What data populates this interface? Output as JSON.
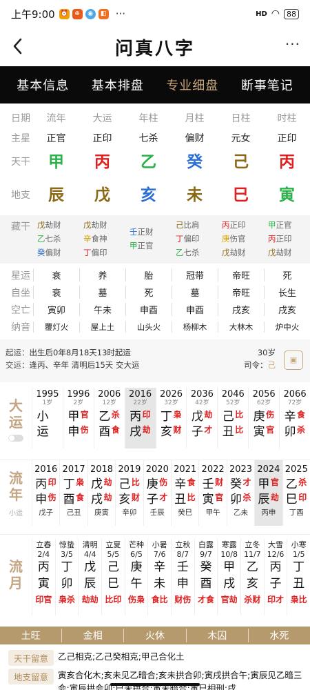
{
  "status_bar": {
    "time": "上午9:00",
    "signal": "HD",
    "battery": "88"
  },
  "header": {
    "title": "问真八字"
  },
  "tabs": [
    {
      "label": "基本信息",
      "active": false
    },
    {
      "label": "基本排盘",
      "active": false
    },
    {
      "label": "专业细盘",
      "active": true
    },
    {
      "label": "断事笔记",
      "active": false
    }
  ],
  "pillars": {
    "labels": {
      "date": "日期",
      "zhuxing": "主星",
      "tiangan": "天干",
      "dizhi": "地支",
      "canggan": "藏干",
      "xingyun": "星运",
      "zizuo": "自坐",
      "kongwang": "空亡",
      "nayin": "纳音"
    },
    "columns": [
      {
        "name": "流年",
        "zhuxing": "正官",
        "gan": "甲",
        "gan_el": "wood",
        "zhi": "辰",
        "zhi_el": "earth",
        "canggan": [
          {
            "g": "戊",
            "el": "earth",
            "s": "劫财"
          },
          {
            "g": "乙",
            "el": "wood",
            "s": "七杀"
          },
          {
            "g": "癸",
            "el": "water",
            "s": "偏财"
          }
        ],
        "xingyun": "衰",
        "zizuo": "衰",
        "kong": "寅卯",
        "nayin": "覆灯火"
      },
      {
        "name": "大运",
        "zhuxing": "正印",
        "gan": "丙",
        "gan_el": "fire",
        "zhi": "戊",
        "zhi_el": "earth",
        "canggan": [
          {
            "g": "戊",
            "el": "earth",
            "s": "劫财"
          },
          {
            "g": "辛",
            "el": "metal",
            "s": "食神"
          },
          {
            "g": "丁",
            "el": "fire",
            "s": "偏印"
          }
        ],
        "xingyun": "养",
        "zizuo": "墓",
        "kong": "午未",
        "nayin": "屋上土"
      },
      {
        "name": "年柱",
        "zhuxing": "七杀",
        "gan": "乙",
        "gan_el": "wood",
        "zhi": "亥",
        "zhi_el": "water",
        "canggan": [
          {
            "g": "壬",
            "el": "water",
            "s": "正财"
          },
          {
            "g": "甲",
            "el": "wood",
            "s": "正官"
          }
        ],
        "xingyun": "胎",
        "zizuo": "死",
        "kong": "申酉",
        "nayin": "山头火"
      },
      {
        "name": "月柱",
        "zhuxing": "偏财",
        "gan": "癸",
        "gan_el": "water",
        "zhi": "未",
        "zhi_el": "earth",
        "canggan": [
          {
            "g": "己",
            "el": "earth",
            "s": "比肩"
          },
          {
            "g": "丁",
            "el": "fire",
            "s": "偏印"
          },
          {
            "g": "乙",
            "el": "wood",
            "s": "七杀"
          }
        ],
        "xingyun": "冠带",
        "zizuo": "墓",
        "kong": "申酉",
        "nayin": "杨柳木"
      },
      {
        "name": "日柱",
        "zhuxing": "元女",
        "gan": "己",
        "gan_el": "earth",
        "zhi": "巳",
        "zhi_el": "fire",
        "canggan": [
          {
            "g": "丙",
            "el": "fire",
            "s": "正印"
          },
          {
            "g": "庚",
            "el": "metal",
            "s": "伤官"
          },
          {
            "g": "戊",
            "el": "earth",
            "s": "劫财"
          }
        ],
        "xingyun": "帝旺",
        "zizuo": "帝旺",
        "kong": "戌亥",
        "nayin": "大林木"
      },
      {
        "name": "时柱",
        "zhuxing": "正印",
        "gan": "丙",
        "gan_el": "fire",
        "zhi": "寅",
        "zhi_el": "wood",
        "canggan": [
          {
            "g": "甲",
            "el": "wood",
            "s": "正官"
          },
          {
            "g": "丙",
            "el": "fire",
            "s": "正印"
          },
          {
            "g": "戊",
            "el": "earth",
            "s": "劫财"
          }
        ],
        "xingyun": "死",
        "zizuo": "长生",
        "kong": "戌亥",
        "nayin": "炉中火"
      }
    ]
  },
  "qiyun": {
    "qiyun_label": "起运：",
    "qiyun_text": "出生后0年8月18天13时起运",
    "jiaoyun_label": "交运：",
    "jiaoyun_text": "逢丙、辛年 清明后15天 交大运",
    "age": "30岁",
    "siling_label": "司令：",
    "siling_value": "己"
  },
  "dayun": {
    "label1": "大",
    "label2": "运",
    "items": [
      {
        "year": "1995",
        "age": "1岁",
        "g": "小",
        "gs": "",
        "z": "运",
        "zs": "",
        "sel": false
      },
      {
        "year": "1996",
        "age": "2岁",
        "g": "甲",
        "gs": "官",
        "gel": "fire",
        "z": "申",
        "zs": "伤",
        "zel": "fire",
        "sel": false
      },
      {
        "year": "2006",
        "age": "12岁",
        "g": "乙",
        "gs": "杀",
        "gel": "fire",
        "z": "酉",
        "zs": "食",
        "zel": "fire",
        "sel": false
      },
      {
        "year": "2016",
        "age": "22岁",
        "g": "丙",
        "gs": "印",
        "gel": "fire",
        "z": "戌",
        "zs": "劫",
        "zel": "fire",
        "sel": true
      },
      {
        "year": "2026",
        "age": "32岁",
        "g": "丁",
        "gs": "枭",
        "gel": "fire",
        "z": "亥",
        "zs": "财",
        "zel": "fire",
        "sel": false
      },
      {
        "year": "2036",
        "age": "42岁",
        "g": "戊",
        "gs": "劫",
        "gel": "fire",
        "z": "子",
        "zs": "才",
        "zel": "fire",
        "sel": false
      },
      {
        "year": "2046",
        "age": "52岁",
        "g": "己",
        "gs": "比",
        "gel": "fire",
        "z": "丑",
        "zs": "比",
        "zel": "fire",
        "sel": false
      },
      {
        "year": "2056",
        "age": "62岁",
        "g": "庚",
        "gs": "伤",
        "gel": "fire",
        "z": "寅",
        "zs": "官",
        "zel": "fire",
        "sel": false
      },
      {
        "year": "2066",
        "age": "72岁",
        "g": "辛",
        "gs": "食",
        "gel": "fire",
        "z": "卯",
        "zs": "杀",
        "zel": "fire",
        "sel": false
      }
    ]
  },
  "liunian": {
    "label1": "流",
    "label2": "年",
    "sub": "小运",
    "items": [
      {
        "year": "2016",
        "g": "丙",
        "gs": "印",
        "z": "申",
        "zs": "伤",
        "bot": "戊子",
        "sel": false
      },
      {
        "year": "2017",
        "g": "丁",
        "gs": "枭",
        "z": "酉",
        "zs": "食",
        "bot": "己丑",
        "sel": false
      },
      {
        "year": "2018",
        "g": "戊",
        "gs": "劫",
        "z": "戌",
        "zs": "劫",
        "bot": "庚寅",
        "sel": false
      },
      {
        "year": "2019",
        "g": "己",
        "gs": "比",
        "z": "亥",
        "zs": "财",
        "bot": "辛卯",
        "sel": false
      },
      {
        "year": "2020",
        "g": "庚",
        "gs": "伤",
        "z": "子",
        "zs": "才",
        "bot": "壬辰",
        "sel": false
      },
      {
        "year": "2021",
        "g": "辛",
        "gs": "食",
        "z": "丑",
        "zs": "比",
        "bot": "癸巳",
        "sel": false
      },
      {
        "year": "2022",
        "g": "壬",
        "gs": "财",
        "z": "寅",
        "zs": "官",
        "bot": "甲午",
        "sel": false
      },
      {
        "year": "2023",
        "g": "癸",
        "gs": "才",
        "z": "卯",
        "zs": "杀",
        "bot": "乙未",
        "sel": false
      },
      {
        "year": "2024",
        "g": "甲",
        "gs": "官",
        "z": "辰",
        "zs": "劫",
        "bot": "丙申",
        "sel": true
      },
      {
        "year": "2025",
        "g": "乙",
        "gs": "杀",
        "z": "巳",
        "zs": "印",
        "bot": "丁酉",
        "sel": false
      }
    ]
  },
  "liuyue": {
    "label1": "流",
    "label2": "月",
    "items": [
      {
        "jq": "立春",
        "dt": "2/4",
        "g": "丙",
        "z": "寅",
        "ss": "印官"
      },
      {
        "jq": "惊蛰",
        "dt": "3/5",
        "g": "丁",
        "z": "卯",
        "ss": "枭杀"
      },
      {
        "jq": "清明",
        "dt": "4/4",
        "g": "戊",
        "z": "辰",
        "ss": "劫劫"
      },
      {
        "jq": "立夏",
        "dt": "5/5",
        "g": "己",
        "z": "巳",
        "ss": "比印"
      },
      {
        "jq": "芒种",
        "dt": "6/5",
        "g": "庚",
        "z": "午",
        "ss": "伤枭"
      },
      {
        "jq": "小暑",
        "dt": "7/6",
        "g": "辛",
        "z": "未",
        "ss": "食比"
      },
      {
        "jq": "立秋",
        "dt": "8/7",
        "g": "壬",
        "z": "申",
        "ss": "财伤"
      },
      {
        "jq": "白露",
        "dt": "9/7",
        "g": "癸",
        "z": "酉",
        "ss": "才食"
      },
      {
        "jq": "寒露",
        "dt": "10/8",
        "g": "甲",
        "z": "戌",
        "ss": "官劫"
      },
      {
        "jq": "立冬",
        "dt": "11/7",
        "g": "乙",
        "z": "亥",
        "ss": "杀财"
      },
      {
        "jq": "大雪",
        "dt": "12/6",
        "g": "丙",
        "z": "子",
        "ss": "印才"
      },
      {
        "jq": "小寒",
        "dt": "1/5",
        "g": "丁",
        "z": "丑",
        "ss": "枭比"
      }
    ]
  },
  "wuxing": [
    "土旺",
    "金相",
    "火休",
    "木囚",
    "水死"
  ],
  "notes": {
    "tiangan_tag": "天干留意",
    "tiangan_text": "乙己相克;乙己癸相克;甲己合化土",
    "dizhi_tag": "地支留意",
    "dizhi_text": "寅亥合化木;亥未见乙暗合;亥未拱合卯;寅戌拱合午;寅辰见乙暗三会;寅辰拱会卯;巳未拱合;寅未暗合;寅巳相刑;戌"
  },
  "colors": {
    "wood": "#2bb24a",
    "fire": "#e02020",
    "earth": "#8b6914",
    "water": "#2a6fd6",
    "metal": "#d8a200",
    "accent": "#c9a77c"
  }
}
